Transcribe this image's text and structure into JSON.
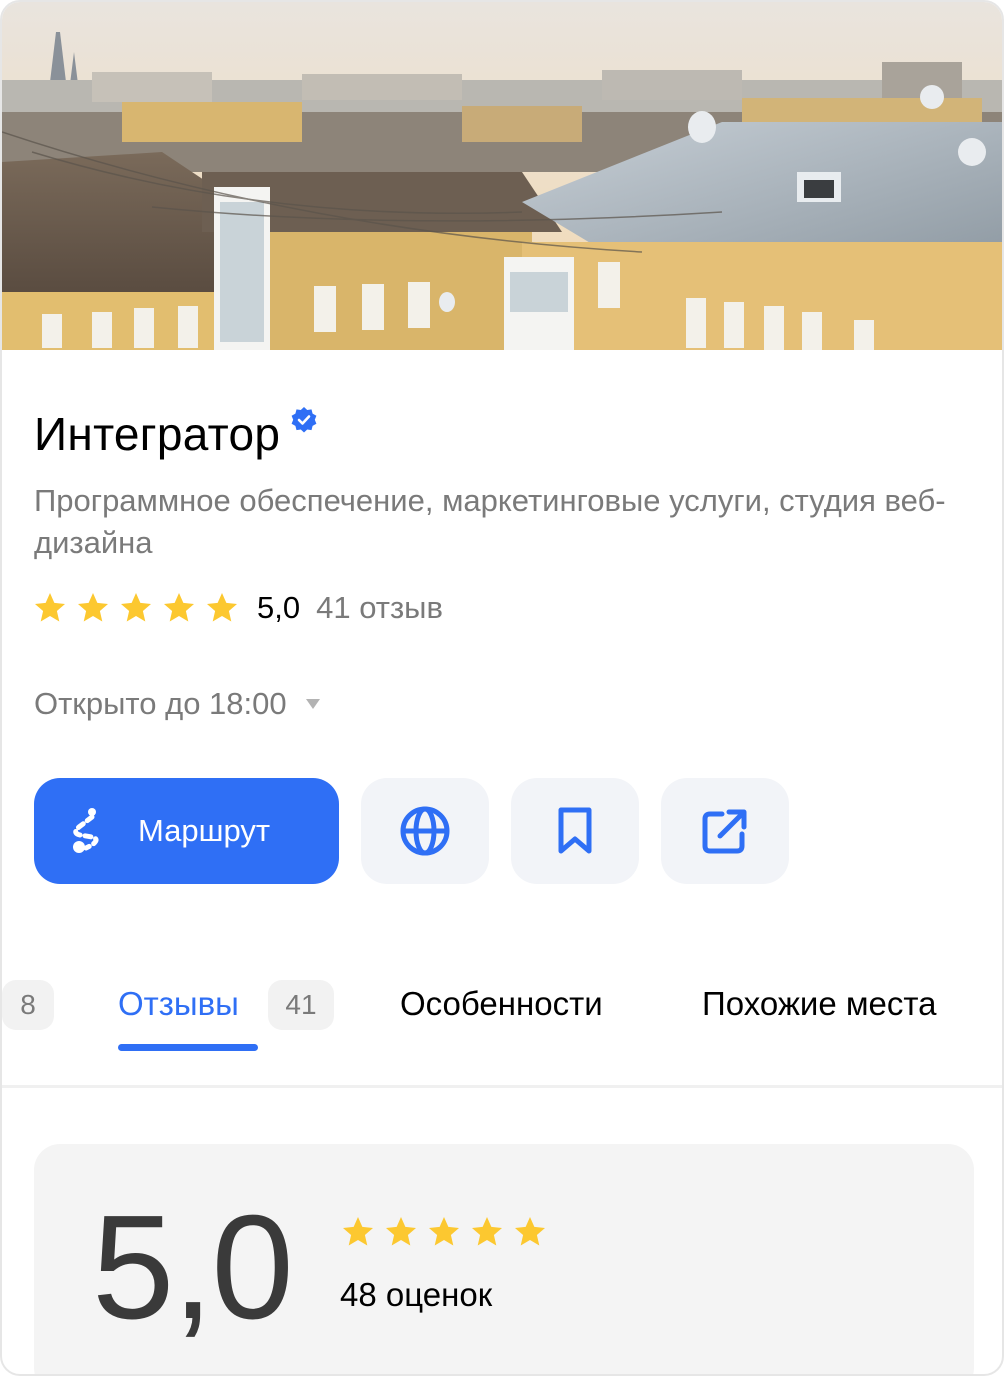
{
  "place": {
    "name": "Интегратор",
    "verified": true,
    "category": "Программное обеспечение, маркетинговые услуги, студия веб-дизайна",
    "rating": "5,0",
    "stars_filled": 5,
    "reviews_count_label": "41 отзыв",
    "hours": "Открыто до 18:00"
  },
  "actions": {
    "route_label": "Маршрут",
    "icons": [
      "globe-icon",
      "bookmark-icon",
      "share-icon"
    ]
  },
  "tabs": {
    "partial_badge": "8",
    "items": [
      {
        "label": "Отзывы",
        "badge": "41",
        "active": true
      },
      {
        "label": "Особенности",
        "active": false
      },
      {
        "label": "Похожие места",
        "active": false
      }
    ]
  },
  "summary": {
    "rating": "5,0",
    "stars_filled": 5,
    "ratings_count": "48 оценок"
  },
  "colors": {
    "accent": "#2f6ff5",
    "star": "#fcc830",
    "muted_text": "#7a7a7a",
    "button_bg": "#f2f4f8"
  }
}
